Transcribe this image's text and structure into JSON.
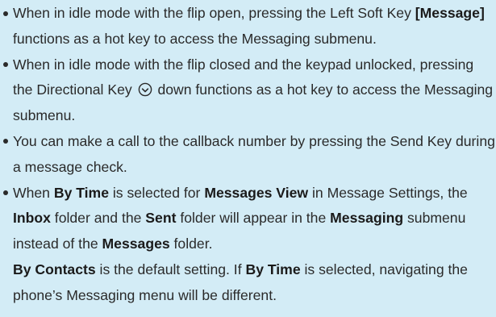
{
  "notes": [
    {
      "parts": [
        "When in idle mode with the flip open, pressing the Left Soft Key ",
        "[Message]",
        " functions as a hot key to access the Messaging submenu."
      ]
    },
    {
      "parts": [
        "When in idle mode with the flip closed and the keypad unlocked, pressing the Directional Key ",
        " down functions as a hot key to access the Messaging submenu."
      ],
      "icon": "directional-key-icon"
    },
    {
      "parts": [
        "You can make a call to the callback number by pressing the Send Key during a message check."
      ]
    },
    {
      "parts": [
        "When ",
        "By Time",
        " is selected for ",
        "Messages View",
        " in Message Settings, the ",
        "Inbox",
        " folder and the ",
        "Sent",
        " folder will appear in the ",
        "Messaging",
        " submenu instead of the ",
        "Messages",
        " folder.",
        "By Contacts",
        " is the default setting. If ",
        "By Time",
        " is selected, navigating the phone’s Messaging menu will be different."
      ]
    }
  ],
  "colors": {
    "background": "#d3ecf6",
    "text": "#2a2a2a"
  }
}
